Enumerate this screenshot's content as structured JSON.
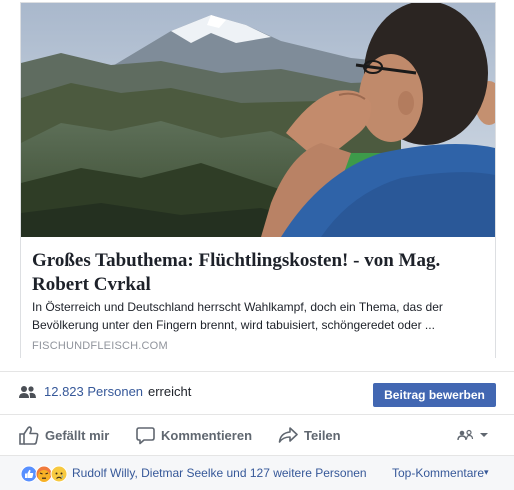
{
  "post": {
    "link_title": "Großes Tabuthema: Flüchtlingskosten! - von Mag. Robert Cvrkal",
    "link_description": "In Österreich und Deutschland herrscht Wahlkampf, doch ein Thema, das der Bevölkerung unter den Fingern brennt, wird tabuisiert, schöngeredet oder ...",
    "link_domain": "FISCHUNDFLEISCH.COM"
  },
  "reach": {
    "count": "12.823 Personen",
    "suffix": "erreicht",
    "promote_label": "Beitrag bewerben"
  },
  "actions": {
    "like": "Gefällt mir",
    "comment": "Kommentieren",
    "share": "Teilen"
  },
  "reactions": {
    "names": "Rudolf Willy, Dietmar Seelke und 127 weitere Personen",
    "top_comments": "Top-Kommentare"
  },
  "colors": {
    "link_blue": "#365899",
    "button_blue": "#4267b2",
    "action_gray": "#606770"
  },
  "icons": {
    "reach": "people-icon",
    "like": "thumbs-up-icon",
    "comment": "comment-bubble-icon",
    "share": "share-arrow-icon",
    "audience": "friends-icon",
    "reactions": [
      "like-reaction-icon",
      "angry-reaction-icon",
      "sad-reaction-icon"
    ]
  }
}
